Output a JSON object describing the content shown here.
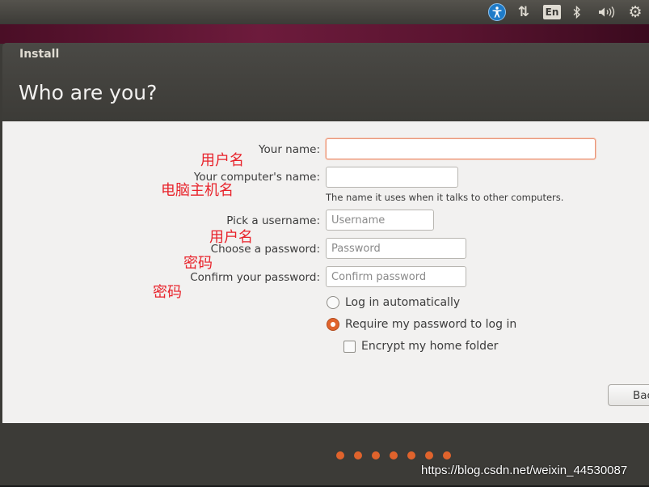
{
  "panel": {
    "lang_indicator": "En",
    "icons": [
      "accessibility-icon",
      "network-icon",
      "keyboard-layout-indicator",
      "bluetooth-icon",
      "volume-icon",
      "gear-icon"
    ]
  },
  "window": {
    "title": "Install",
    "heading": "Who are you?"
  },
  "form": {
    "your_name_label": "Your name:",
    "your_name_value": "",
    "computer_name_label": "Your computer's name:",
    "computer_name_value": "",
    "computer_name_hint": "The name it uses when it talks to other computers.",
    "username_label": "Pick a username:",
    "username_placeholder": "Username",
    "password_label": "Choose a password:",
    "password_placeholder": "Password",
    "confirm_label": "Confirm your password:",
    "confirm_placeholder": "Confirm password",
    "login_auto_label": "Log in automatically",
    "require_password_label": "Require my password to log in",
    "encrypt_home_label": "Encrypt my home folder",
    "login_mode_selected": "require_password",
    "encrypt_home_checked": false
  },
  "annotations": {
    "name": "用户名",
    "computer_name": "电脑主机名",
    "username": "用户名",
    "password": "密码",
    "confirm": "密码"
  },
  "buttons": {
    "back_label": "Back"
  },
  "progress": {
    "dot_count": 7
  },
  "watermark": "https://blog.csdn.net/weixin_44530087",
  "colors": {
    "accent": "#e0632c",
    "panel": "#3c3b37",
    "annotation": "#e8232b",
    "accessibility": "#1e7bc8"
  }
}
